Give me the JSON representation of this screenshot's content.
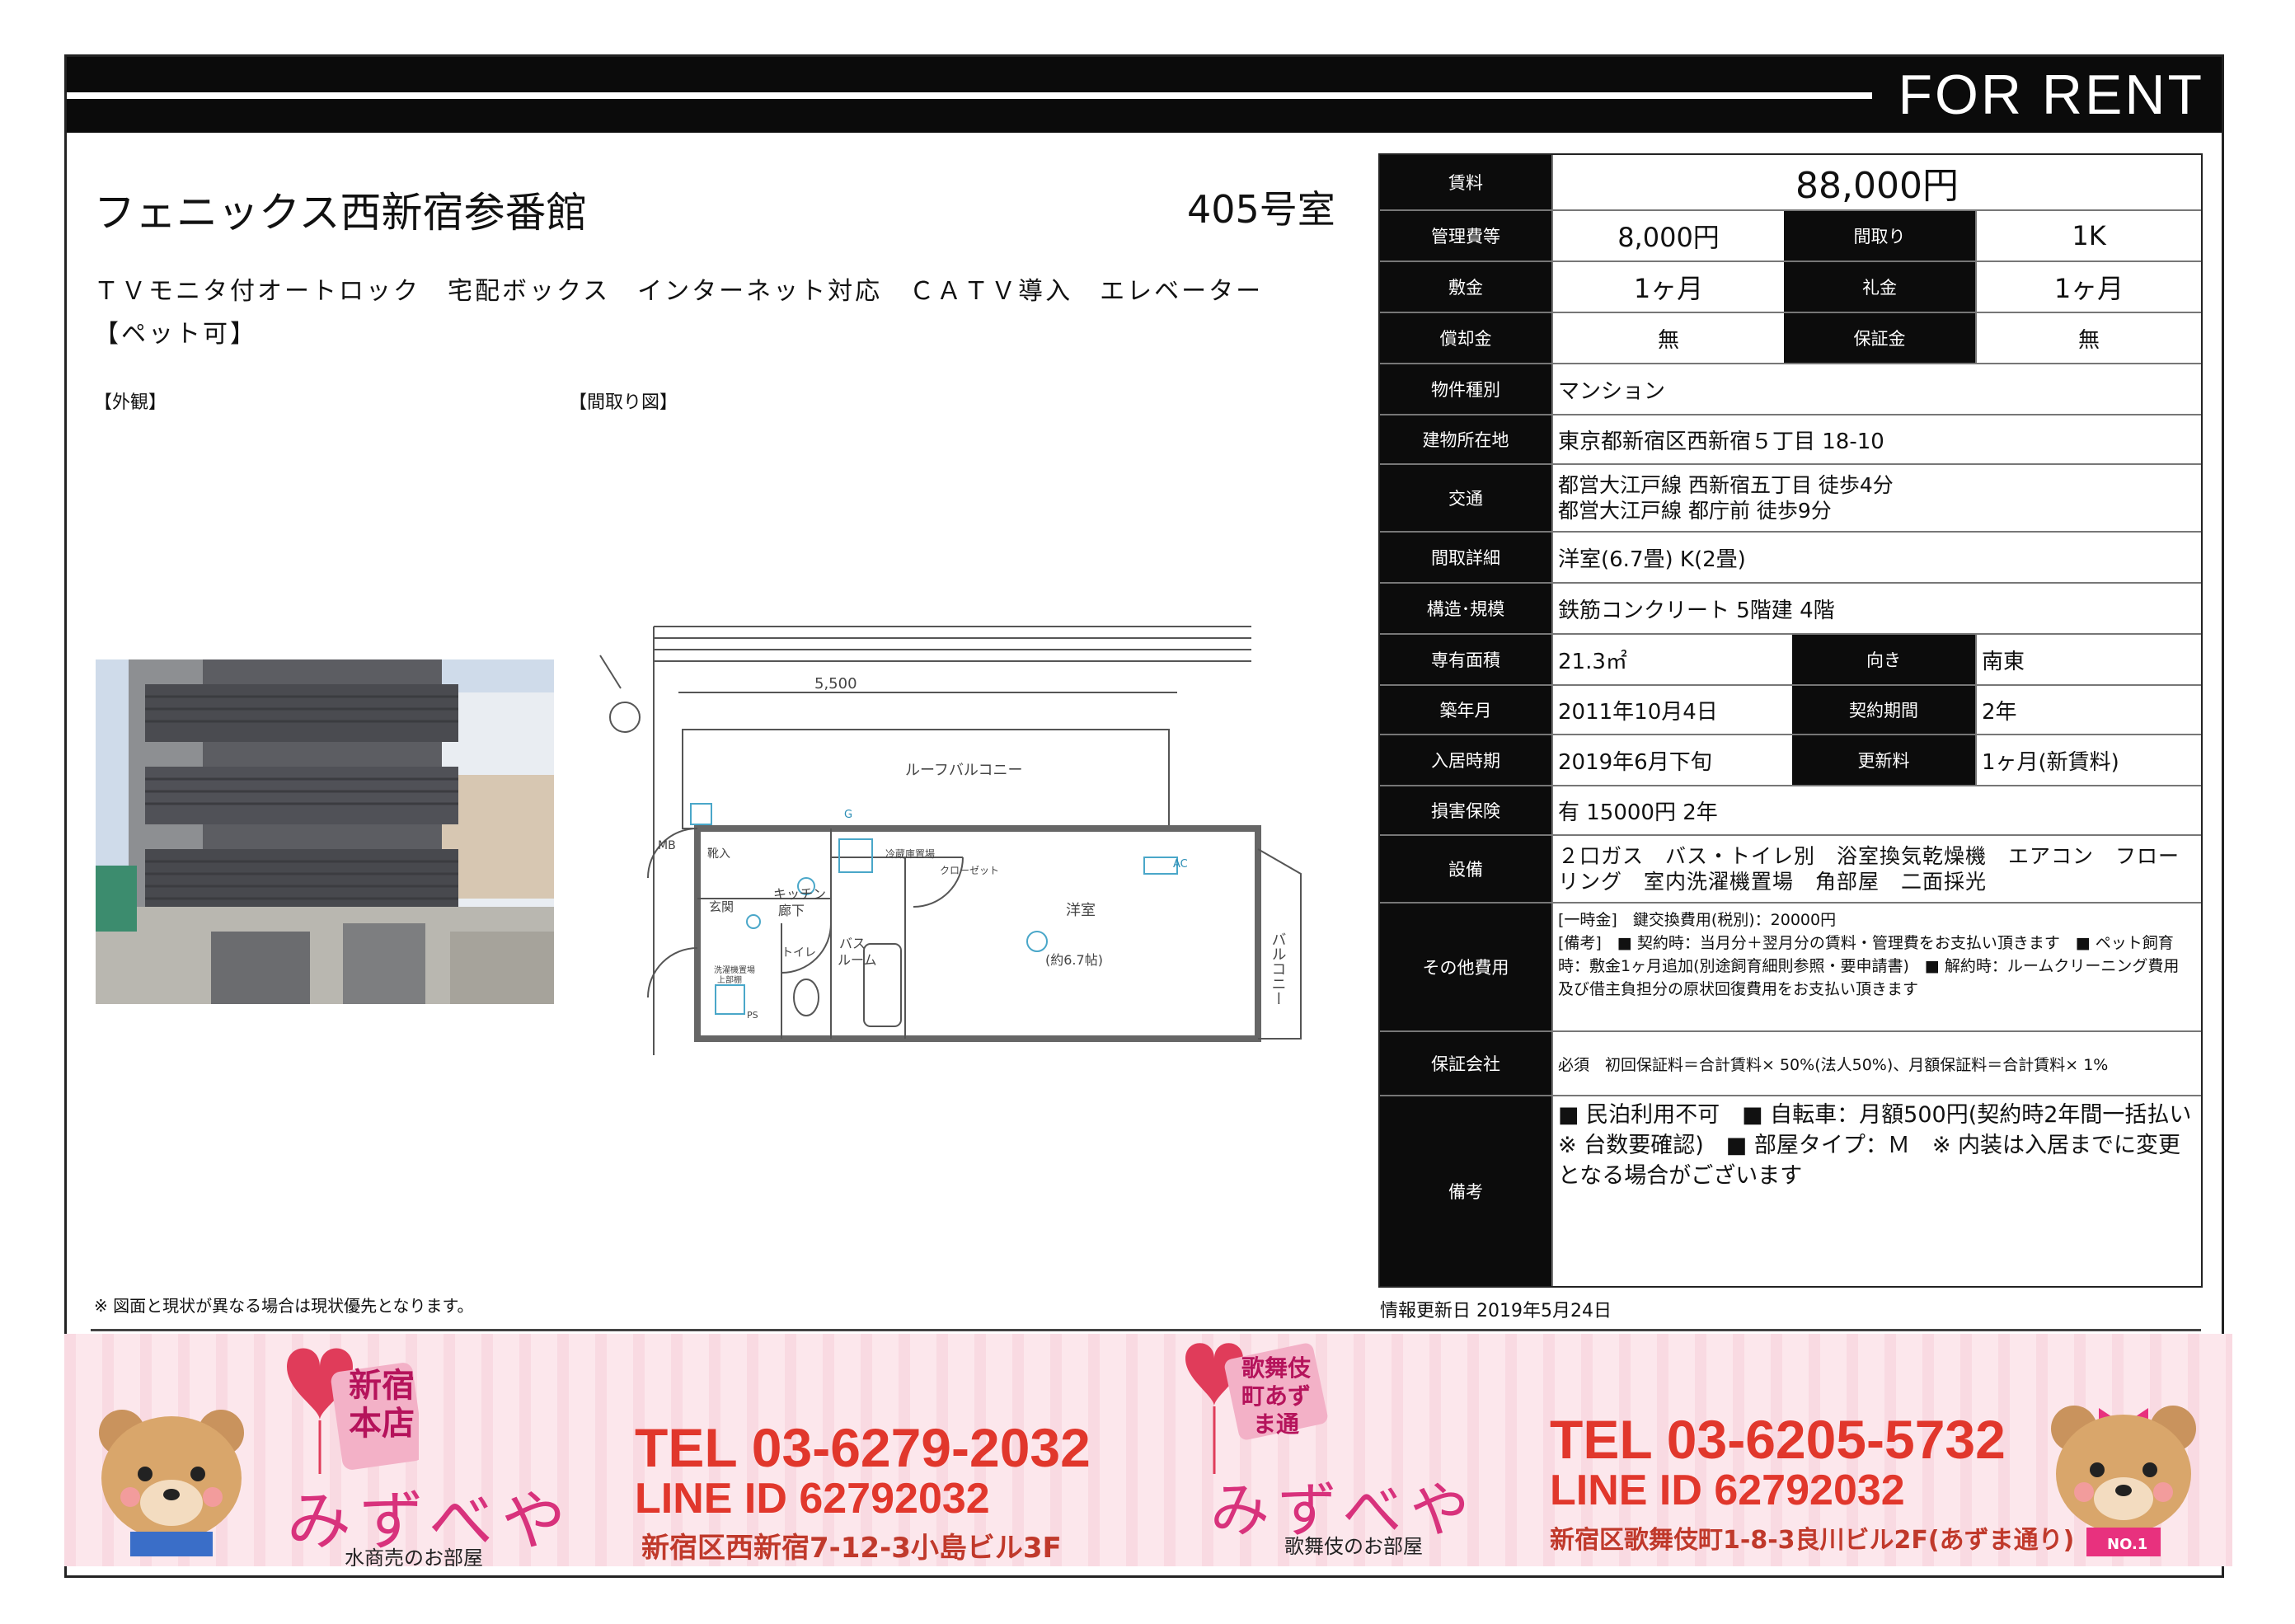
{
  "header": {
    "title": "FOR RENT"
  },
  "property": {
    "name": "フェニックス西新宿参番館",
    "room": "405号室",
    "features_line1": "ＴＶモニタ付オートロック　宅配ボックス　インターネット対応　ＣＡＴＶ導入　エレベーター",
    "features_line2": "【ペット可】"
  },
  "sections": {
    "exterior_label": "【外観】",
    "floorplan_label": "【間取り図】"
  },
  "floorplan": {
    "width_dim": "5,500",
    "roof_balcony": "ルーフバルコニー",
    "balcony": "バルコニー",
    "mb": "MB",
    "shoebox": "靴入",
    "kitchen": "キッチン",
    "corridor": "廊下",
    "fridge": "冷蔵庫置場",
    "closet": "クローゼット",
    "entrance": "玄関",
    "toilet": "トイレ",
    "bath": "バス",
    "bath2": "ルーム",
    "washer": "洗濯機置場",
    "washer2": "上部棚",
    "ps": "PS",
    "room": "洋室",
    "room_size": "(約6.7帖)",
    "ac": "AC",
    "g": "G"
  },
  "table": {
    "rent_label": "賃料",
    "rent": "88,000円",
    "mgmt_label": "管理費等",
    "mgmt": "8,000円",
    "layout_label": "間取り",
    "layout": "1K",
    "deposit_label": "敷金",
    "deposit": "1ヶ月",
    "keymoney_label": "礼金",
    "keymoney": "1ヶ月",
    "amort_label": "償却金",
    "amort": "無",
    "guarantee_label": "保証金",
    "guarantee": "無",
    "type_label": "物件種別",
    "type": "マンション",
    "address_label": "建物所在地",
    "address": "東京都新宿区西新宿５丁目 18-10",
    "access_label": "交通",
    "access1": "都営大江戸線 西新宿五丁目 徒歩4分",
    "access2": "都営大江戸線 都庁前 徒歩9分",
    "rooms_label": "間取詳細",
    "rooms": "洋室(6.7畳) K(2畳)",
    "structure_label": "構造･規模",
    "structure": "鉄筋コンクリート 5階建 4階",
    "area_label": "専有面積",
    "area": "21.3㎡",
    "direction_label": "向き",
    "direction": "南東",
    "built_label": "築年月",
    "built": "2011年10月4日",
    "term_label": "契約期間",
    "term": "2年",
    "movein_label": "入居時期",
    "movein": "2019年6月下旬",
    "renewal_label": "更新料",
    "renewal": "1ヶ月(新賃料)",
    "insurance_label": "損害保険",
    "insurance": "有  15000円 2年",
    "equipment_label": "設備",
    "equipment": "２口ガス　バス・トイレ別　浴室換気乾燥機　エアコン　フローリング　室内洗濯機置場　角部屋　二面採光",
    "other_label": "その他費用",
    "other": "[一時金]　鍵交換費用(税別)：20000円\n[備考]　■ 契約時：当月分＋翌月分の賃料・管理費をお支払い頂きます　■ ペット飼育時：敷金1ヶ月追加(別途飼育細則参照・要申請書)　■ 解約時：ルームクリーニング費用及び借主負担分の原状回復費用をお支払い頂きます",
    "guarantor_label": "保証会社",
    "guarantor": "必須　初回保証料＝合計賃料× 50%(法人50%)、月額保証料＝合計賃料× 1%",
    "remarks_label": "備考",
    "remarks": "■ 民泊利用不可　■ 自転車：月額500円(契約時2年間一括払い※ 台数要確認)　■ 部屋タイプ：Ｍ　※ 内装は入居までに変更となる場合がございます"
  },
  "footer": {
    "note": "※ 図面と現状が異なる場合は現状優先となります。",
    "updated": "情報更新日 2019年5月24日"
  },
  "banner": {
    "left_badge": "新宿本店",
    "left_brand": "みずべや",
    "left_sub": "水商売のお部屋",
    "left_tel": "TEL 03-6279-2032",
    "left_line": "LINE ID 62792032",
    "left_addr": "新宿区西新宿7-12-3小島ビル3F",
    "right_badge": "歌舞伎町あずま通",
    "right_brand": "みずべや",
    "right_sub": "歌舞伎のお部屋",
    "right_tel": "TEL 03-6205-5732",
    "right_line": "LINE ID 62792032",
    "right_addr": "新宿区歌舞伎町1-8-3良川ビル2F(あずま通り)",
    "bear_tag": "NO.1"
  }
}
